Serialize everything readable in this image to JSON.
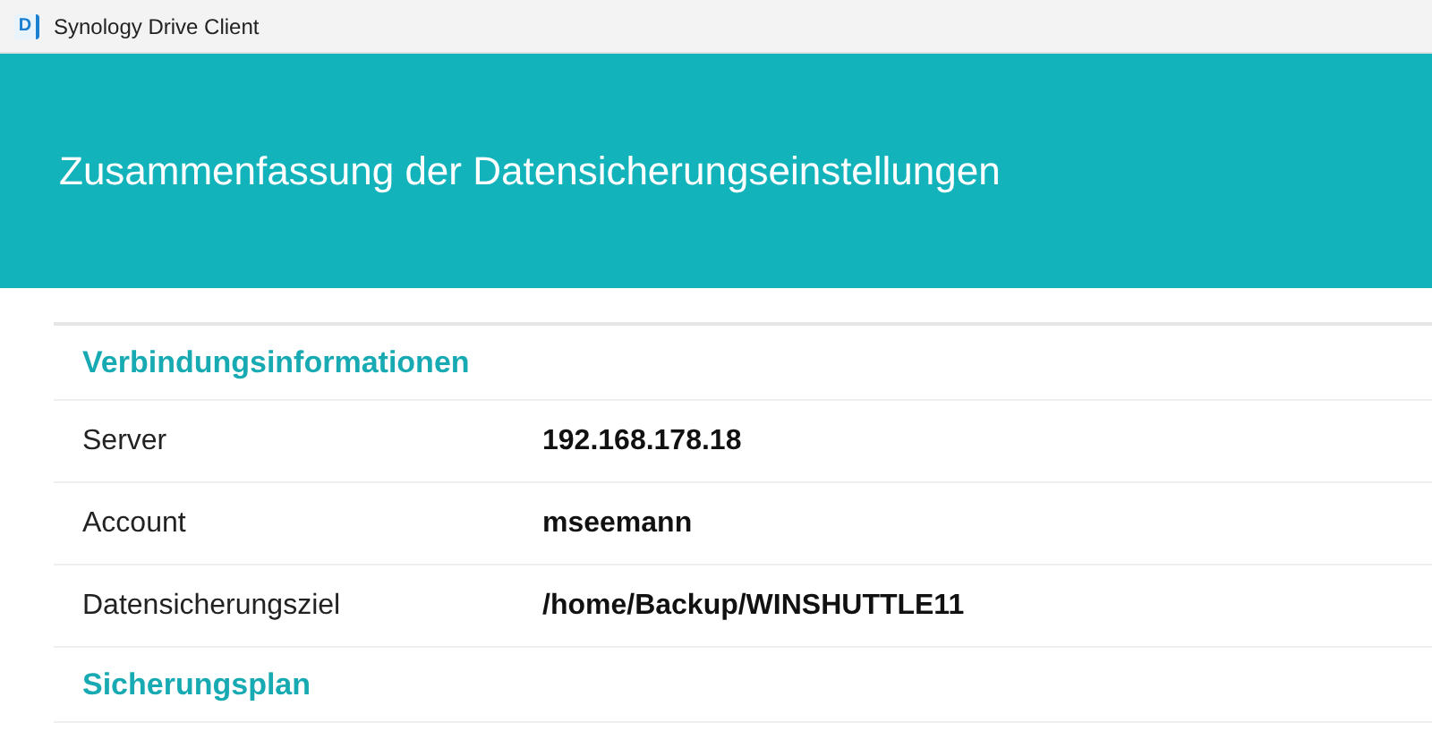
{
  "window": {
    "title": "Synology Drive Client",
    "logo_text": "D"
  },
  "banner": {
    "title": "Zusammenfassung der Datensicherungseinstellungen"
  },
  "sections": [
    {
      "title": "Verbindungsinformationen",
      "rows": [
        {
          "label": "Server",
          "value": "192.168.178.18"
        },
        {
          "label": "Account",
          "value": "mseemann"
        },
        {
          "label": "Datensicherungsziel",
          "value": "/home/Backup/WINSHUTTLE11"
        }
      ]
    },
    {
      "title": "Sicherungsplan"
    }
  ]
}
